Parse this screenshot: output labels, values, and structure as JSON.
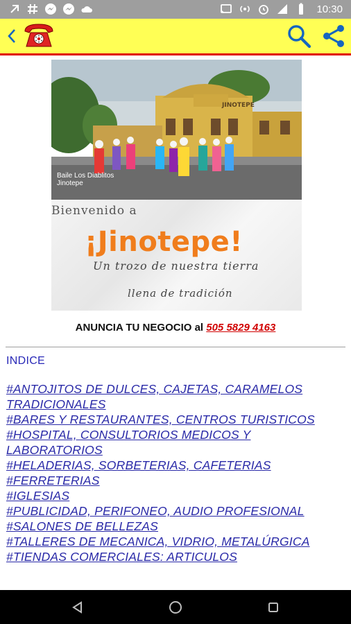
{
  "status_bar": {
    "time": "10:30",
    "left_icons": [
      "back-arrow-icon",
      "hashtag-icon",
      "messenger-icon",
      "messenger-icon",
      "cloud-icon"
    ],
    "right_icons": [
      "cast-icon",
      "hotspot-icon",
      "alarm-icon",
      "signal-icon",
      "battery-icon"
    ]
  },
  "app_bar": {
    "background": "#ffff55",
    "border_color": "#e00000",
    "icons": [
      "back-icon",
      "red-telephone-icon",
      "search-icon",
      "share-icon"
    ],
    "accent": "#1565c0"
  },
  "banner": {
    "photo_caption_line1": "Baile Los Diablitos",
    "photo_caption_line2": "Jinotepe",
    "building_sign": "JINOTEPE",
    "welcome": "Bienvenido a",
    "city": "¡Jinotepe!",
    "tagline1": "Un trozo de nuestra tierra",
    "tagline2": "llena de tradición"
  },
  "announce": {
    "text": "ANUNCIA TU NEGOCIO al ",
    "phone": "505 5829 4163"
  },
  "index": {
    "heading": "INDICE",
    "items": [
      "#ANTOJITOS DE DULCES, CAJETAS, CARAMELOS TRADICIONALES",
      "#BARES Y RESTAURANTES, CENTROS TURISTICOS",
      "#HOSPITAL, CONSULTORIOS MEDICOS Y LABORATORIOS",
      "#HELADERIAS, SORBETERIAS, CAFETERIAS",
      "#FERRETERIAS",
      "#IGLESIAS",
      "#PUBLICIDAD, PERIFONEO, AUDIO PROFESIONAL",
      "#SALONES DE BELLEZAS",
      "#TALLERES DE MECANICA, VIDRIO, METALÚRGICA",
      "#TIENDAS COMERCIALES: ARTICULOS"
    ]
  },
  "nav_bar": {
    "icons": [
      "back-triangle-icon",
      "home-circle-icon",
      "recents-square-icon"
    ]
  }
}
